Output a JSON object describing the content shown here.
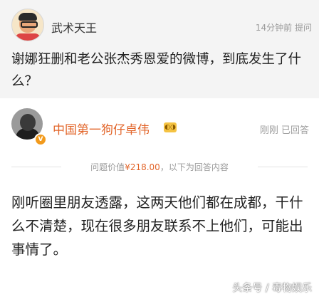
{
  "question": {
    "author": "武术天王",
    "meta": "14分钟前 提问",
    "text": "谢娜狂删和老公张杰秀恩爱的微博，到底发生了什么？"
  },
  "answer": {
    "author": "中国第一狗仔卓伟",
    "meta": "刚刚 已回答",
    "price_prefix": "问题价值",
    "price": "¥218.00",
    "price_suffix": "，以下为回答内容",
    "text": "刚听圈里朋友透露，这两天他们都在成都，干什么不清楚，现在很多朋友联系不上他们，可能出事情了。"
  },
  "watermark": "头条号 / 毒物娱乐",
  "colors": {
    "accent": "#e2652a",
    "question_bg": "#f4f4f4"
  }
}
